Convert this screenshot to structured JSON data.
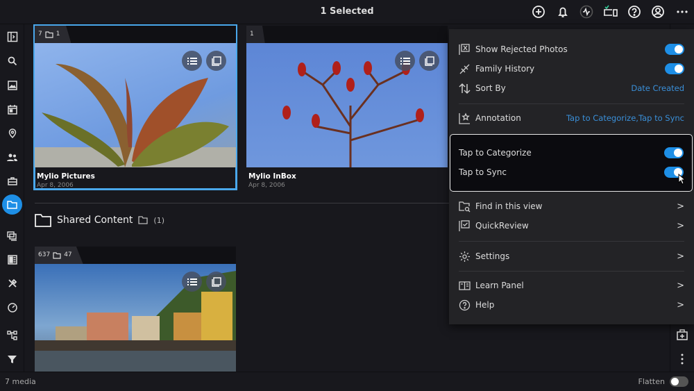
{
  "header": {
    "title": "1 Selected",
    "icons": [
      "add-icon",
      "bell-icon",
      "activity-icon",
      "devices-icon",
      "help-icon",
      "account-icon",
      "more-icon"
    ]
  },
  "sidebar": {
    "icons": [
      "panel-toggle-icon",
      "search-icon",
      "photos-icon",
      "calendar-icon",
      "map-pin-icon",
      "people-icon",
      "briefcase-icon",
      "folder-icon",
      "duplicates-icon",
      "dashboard-icon",
      "tools-icon",
      "speed-icon",
      "sources-icon",
      "filter-icon"
    ]
  },
  "cards": [
    {
      "count": "7",
      "folders": "1",
      "name": "Mylio Pictures",
      "date": "Apr 8, 2006"
    },
    {
      "count": "1",
      "folders": "",
      "name": "Mylio InBox",
      "date": "Apr 8, 2006"
    },
    {
      "count": "637",
      "folders": "47",
      "name": "",
      "date": ""
    }
  ],
  "shared": {
    "title": "Shared Content",
    "count": "(1)"
  },
  "menu": {
    "show_rejected": "Show Rejected Photos",
    "family_history": "Family History",
    "sort_by": "Sort By",
    "sort_value": "Date Created",
    "annotation": "Annotation",
    "annotation_value": "Tap to Categorize,Tap to Sync",
    "find": "Find in this view",
    "quickreview": "QuickReview",
    "settings": "Settings",
    "learn": "Learn Panel",
    "help": "Help",
    "chevron": ">"
  },
  "popup": {
    "categorize": "Tap to Categorize",
    "sync": "Tap to Sync"
  },
  "status": {
    "media": "7 media",
    "flatten": "Flatten"
  },
  "colors": {
    "accent": "#1e8fe6",
    "link": "#3a8fd8"
  }
}
